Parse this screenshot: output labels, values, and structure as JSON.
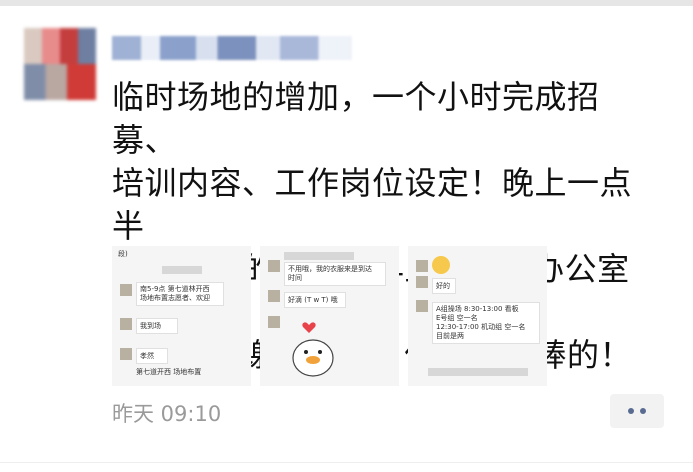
{
  "post": {
    "text": "临时场地的增加，一个小时完成招募、\n培训内容、工作岗位设定！晚上一点半\n还在工作的你们，早上7点30办公室集\n合完毕！谢谢你们！你们是最棒的！",
    "timestamp": "昨天 09:10"
  },
  "thumbnails": [
    {
      "name": "chat-screenshot-1",
      "lines": [
        "段)",
        "南5-9点 第七道林开西",
        "场地布置志愿者、欢迎",
        "我到场",
        "孝然",
        "第七道开西 场地布置"
      ]
    },
    {
      "name": "chat-screenshot-2",
      "lines": [
        "不用哦，我的衣服来是到达",
        "时间",
        "好滴 (T w T) 哦"
      ]
    },
    {
      "name": "chat-screenshot-3",
      "lines": [
        "好的",
        "A组操场 8:30-13:00 看板",
        "E号组 空一名",
        "12:30-17:00 机动组 空一名",
        "目前是两"
      ]
    }
  ],
  "colors": {
    "text": "#111111",
    "timestamp": "#9a9a9a",
    "more_dots": "#596b91",
    "more_bg": "#f2f2f2"
  },
  "icons": {
    "more": "more-dots-icon"
  }
}
